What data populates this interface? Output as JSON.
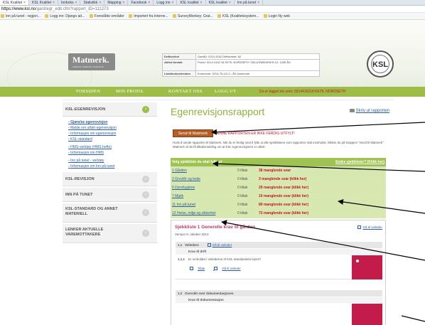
{
  "browser": {
    "tabs": [
      {
        "label": "KSL Kvalitet",
        "active": true
      },
      {
        "label": "KSL Kvalitet",
        "active": false
      },
      {
        "label": "Innboks",
        "active": false
      },
      {
        "label": "Statistikk",
        "active": false
      },
      {
        "label": "Mapping",
        "active": false
      },
      {
        "label": "Facebook",
        "active": false
      },
      {
        "label": "Logg inn",
        "active": false
      },
      {
        "label": "KSL kvalitet",
        "active": false
      },
      {
        "label": "KSL kvalitet",
        "active": false
      },
      {
        "label": "Inn på tunet",
        "active": false
      }
    ],
    "url_host": "https://www.ksl.no",
    "url_path": "/gard/egr_edit.cfm?rapport_ID=111273",
    "bookmarks": [
      "Inn på tunet - regjeri...",
      "Logg inn: Django ad...",
      "Foreslåtte områder",
      "Importert fra Interne...",
      "SurveyMonkey: Grat...",
      "KSL (Kvalitetssystem...",
      "Login Ny web"
    ]
  },
  "header": {
    "logo_text": "Matmerk.",
    "logo_sub": "MENOR GØDAR GÖDLEVE",
    "info": [
      {
        "label": "Driftsenhet",
        "value": "GardID: 0214 4162 Driftsenhet: 62"
      },
      {
        "label": "Aktivt foretak",
        "value": "Produ: 0214 4162 18  KETIL NORDSETH  TØLLERØDVEIEN 12, 1435 ÅS"
      },
      {
        "label": "Landbrukseiendom",
        "value": "Kommune: 0214-75-1/2-0 - ÅS kommune"
      }
    ],
    "ksl_badge": "KSL",
    "nav": [
      "FORSIDEN",
      "MIN PROFIL",
      "KONTAKT OSS",
      "LOGG UT"
    ],
    "login_status": "Du er logget inn som: 0214416218 KETIL NORDSETH"
  },
  "sidebar": {
    "egenrevisjon": {
      "title": "KSL-EGENREVISJON",
      "links": [
        "Gjøre/se egenrevisjon",
        "Melde om utført egenrevisjon",
        "Informasjon om egenrevisjon",
        "KSL-standard",
        "HMS-verktøy (HMS-hefte)",
        "Informasjon om HMS",
        "Inn på tunet - verktøy",
        "Informasjon om Inn på tunet"
      ]
    },
    "sections": [
      "KSL-REVISJON",
      "INN PÅ TUNET",
      "KSL-STANDARD OG ANNET MATERIELL",
      "LENKER AKTUELLE VAREMOTTAKERE"
    ]
  },
  "main": {
    "title": "Egenrevisjonsrapport",
    "print_link": "Skriv ut rapporten",
    "send_button": "Send til Matmerk",
    "warning": "DENNE RAPPORTEN ER IKKE FERDIG UTFYLT!",
    "description": "Husk å sende rapporten til Matmerk. Når du er ferdig med å fylle ut alle sjekklistene som rapporten skal inneholde, klikker du på knappen \"Send til Matmerk\". Matmerk vil da få tilbakemelding om at KSL-egenrevisjonen er utført.",
    "checklist_header": "Velg sjekkliste du skal fylle ut",
    "checklist_other": "Endre sjekklister? (Klikk her)",
    "checklists": [
      {
        "name": "1 Gården",
        "tiltak": "0 tiltak",
        "missing": "38 manglende svar"
      },
      {
        "name": "2 Grovfôr og beite",
        "tiltak": "0 tiltak",
        "missing": "3 manglende svar (klikk her)"
      },
      {
        "name": "5 Dyrehygiene",
        "tiltak": "0 tiltak",
        "missing": "29 manglende svar (klikk her)"
      },
      {
        "name": "7 Mjølk",
        "tiltak": "0 tiltak",
        "missing": "10 manglende svar (klikk her)"
      },
      {
        "name": "11 Inn på tunet",
        "tiltak": "0 tiltak",
        "missing": "80 manglende svar (klikk her)"
      },
      {
        "name": "12 Helse, miljø og sikkerhet",
        "tiltak": "0 tiltak",
        "missing": "72 manglende svar (klikk her)"
      }
    ],
    "sjekkliste": {
      "title": "Sjekkliste 1 Generelle krav til gården",
      "version": "Versjon 9. oktober 2013",
      "guide_link": "Gå til veileder",
      "section1": {
        "num": "1.1",
        "label": "Veiledere",
        "link": "Gå til veileder"
      },
      "sub1": "Krav til drift",
      "q1": {
        "num": "1.1.1",
        "text": "Er innholdet i veilederne til KSL-standardene kjent?",
        "tiltak": "Tiltak",
        "guide": "Gå til veileder"
      },
      "section2": {
        "num": "1.2",
        "label": "Oversikt over dokumentasjonen"
      },
      "sub2": "Krav til dokumentasjon"
    }
  },
  "colors": {
    "green": "#9dbd48",
    "title_green": "#8fb03c",
    "red": "#c8102e",
    "crimson": "#c41c4a",
    "send_button": "#b45e26"
  }
}
